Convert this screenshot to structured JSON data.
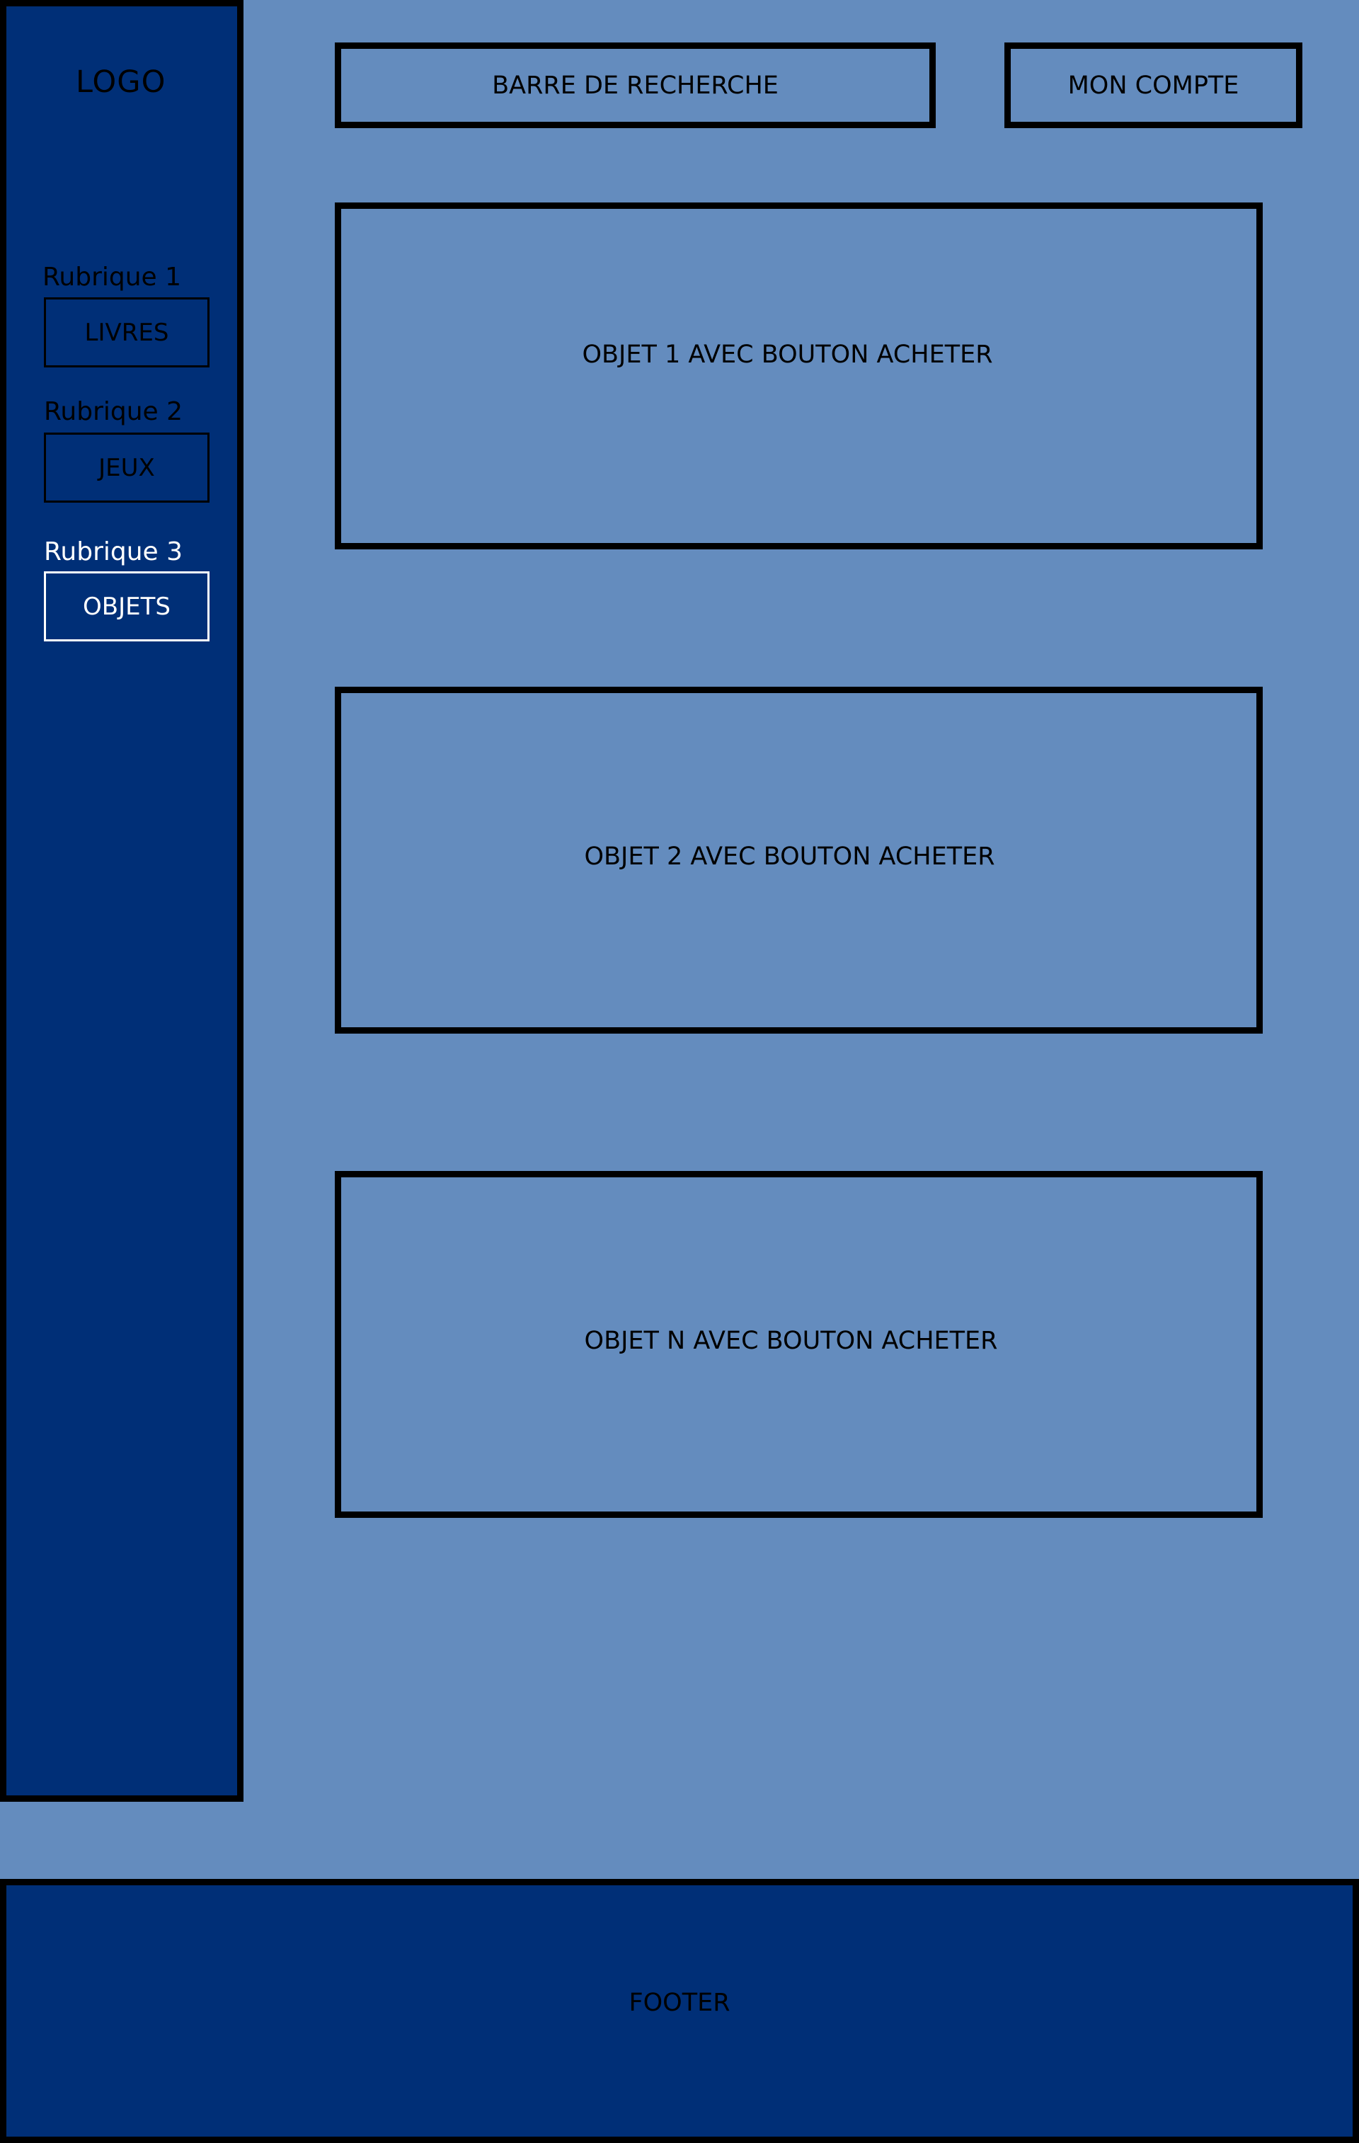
{
  "sidebar": {
    "logo": "LOGO",
    "rubrics": [
      {
        "label": "Rubrique 1",
        "button": "LIVRES",
        "active": false
      },
      {
        "label": "Rubrique 2",
        "button": "JEUX",
        "active": false
      },
      {
        "label": "Rubrique 3",
        "button": "OBJETS",
        "active": true
      }
    ]
  },
  "header": {
    "search": "BARRE DE RECHERCHE",
    "account": "MON COMPTE"
  },
  "products": [
    {
      "label": "OBJET 1 AVEC BOUTON ACHETER"
    },
    {
      "label": "OBJET 2 AVEC BOUTON ACHETER"
    },
    {
      "label": "OBJET N AVEC BOUTON ACHETER"
    }
  ],
  "footer": {
    "label": "FOOTER"
  },
  "colors": {
    "page_background": "#648cbe",
    "panel_background": "#002f77",
    "border": "#000000",
    "active_text": "#ffffff"
  }
}
